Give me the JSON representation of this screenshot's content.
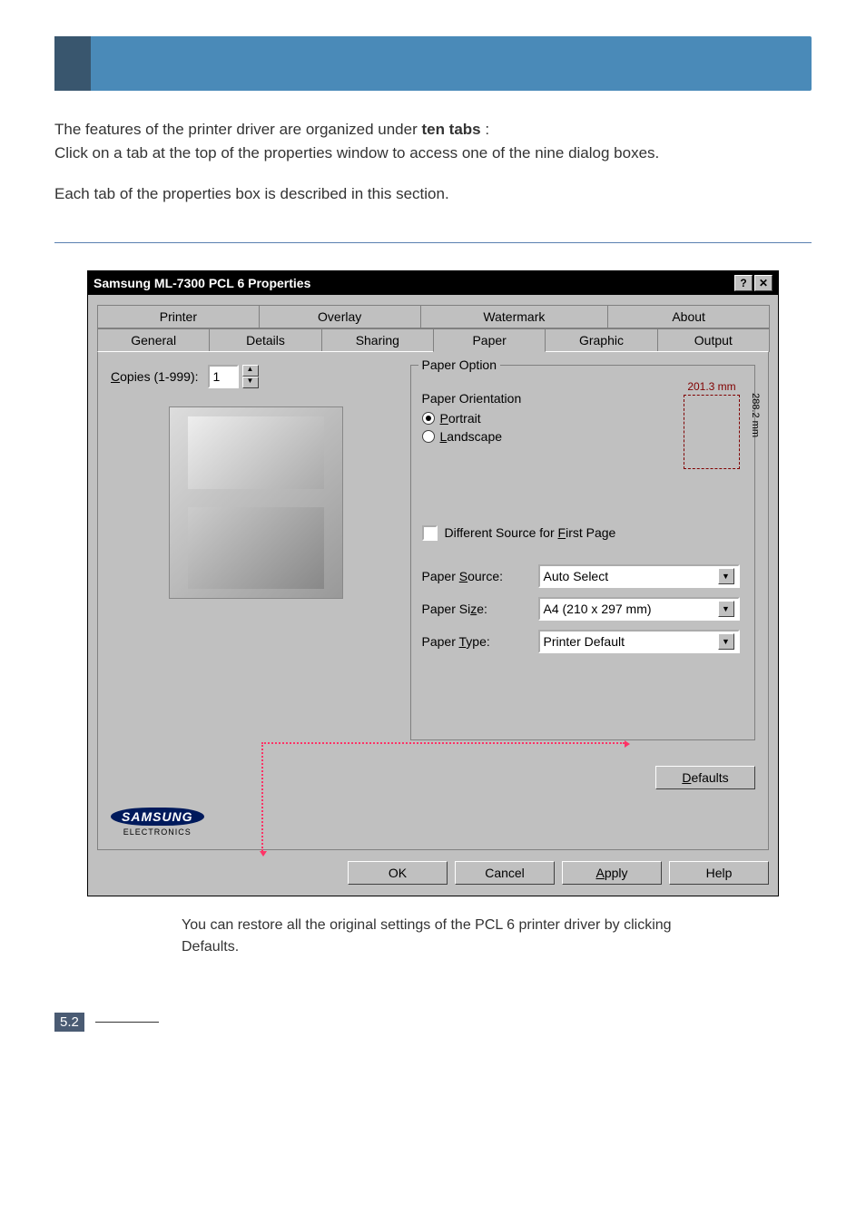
{
  "intro": {
    "line1_prefix": "The features of the printer driver are organized under ",
    "line1_bold": "ten tabs",
    "line1_suffix": " :",
    "line2": "Click on a tab at the top of the properties window to access one of the nine dialog boxes.",
    "line3": "Each tab of the properties box is described in this section."
  },
  "dialog": {
    "title": "Samsung ML-7300 PCL 6 Properties",
    "help_btn": "?",
    "close_btn": "✕",
    "tabs_row1": [
      "Printer",
      "Overlay",
      "Watermark",
      "About"
    ],
    "tabs_row2": [
      "General",
      "Details",
      "Sharing",
      "Paper",
      "Graphic",
      "Output"
    ],
    "active_tab": "Paper",
    "copies_label_pre": "C",
    "copies_label_rest": "opies (1-999):",
    "copies_value": "1",
    "paper_option_legend": "Paper Option",
    "orientation_label": "Paper Orientation",
    "portrait_pre": "P",
    "portrait_rest": "ortrait",
    "landscape_pre": "L",
    "landscape_rest": "andscape",
    "width_mm": "201.3 mm",
    "height_mm": "288.2 mm",
    "diff_source_pre": "Different Source for ",
    "diff_source_u": "F",
    "diff_source_post": "irst Page",
    "paper_source_lbl_pre": "Paper ",
    "paper_source_lbl_u": "S",
    "paper_source_lbl_post": "ource:",
    "paper_source_val": "Auto Select",
    "paper_size_lbl_pre": "Paper Si",
    "paper_size_lbl_u": "z",
    "paper_size_lbl_post": "e:",
    "paper_size_val": "A4 (210 x 297 mm)",
    "paper_type_lbl_pre": "Paper ",
    "paper_type_lbl_u": "T",
    "paper_type_lbl_post": "ype:",
    "paper_type_val": "Printer Default",
    "defaults_btn_u": "D",
    "defaults_btn_rest": "efaults",
    "logo_text": "SAMSUNG",
    "logo_sub": "ELECTRONICS",
    "ok": "OK",
    "cancel": "Cancel",
    "apply_u": "A",
    "apply_rest": "pply",
    "help": "Help"
  },
  "note": "You can restore all the original settings of the PCL 6 printer driver by clicking Defaults.",
  "pagenum_major": "5.",
  "pagenum_minor": "2"
}
